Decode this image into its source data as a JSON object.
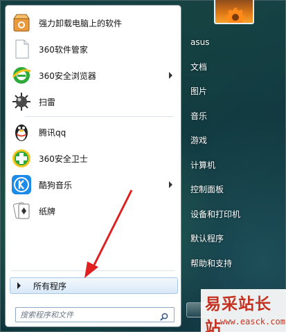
{
  "programs": [
    {
      "label": "强力卸载电脑上的软件",
      "icon": "uninstall-box-icon",
      "has_submenu": false
    },
    {
      "label": "360软件管家",
      "icon": "blank-document-icon",
      "has_submenu": false
    },
    {
      "label": "360安全浏览器",
      "icon": "360-browser-icon",
      "has_submenu": true
    },
    {
      "label": "扫雷",
      "icon": "minesweeper-mine-icon",
      "has_submenu": false
    },
    {
      "label": "腾讯qq",
      "icon": "qq-penguin-icon",
      "has_submenu": false
    },
    {
      "label": "360安全卫士",
      "icon": "360-guard-icon",
      "has_submenu": false
    },
    {
      "label": "酷狗音乐",
      "icon": "kugou-music-icon",
      "has_submenu": true
    },
    {
      "label": "纸牌",
      "icon": "solitaire-cards-icon",
      "has_submenu": false
    }
  ],
  "all_programs": {
    "label": "所有程序"
  },
  "search": {
    "placeholder": "搜索程序和文件"
  },
  "right_panel": {
    "items": [
      "asus",
      "文档",
      "图片",
      "音乐",
      "游戏",
      "计算机",
      "控制面板",
      "设备和打印机",
      "默认程序",
      "帮助和支持"
    ]
  },
  "watermark": {
    "title": "易采站长站",
    "url": "www.easck.com"
  },
  "colors": {
    "annotation_arrow": "#e02020",
    "watermark": "#c53120"
  }
}
